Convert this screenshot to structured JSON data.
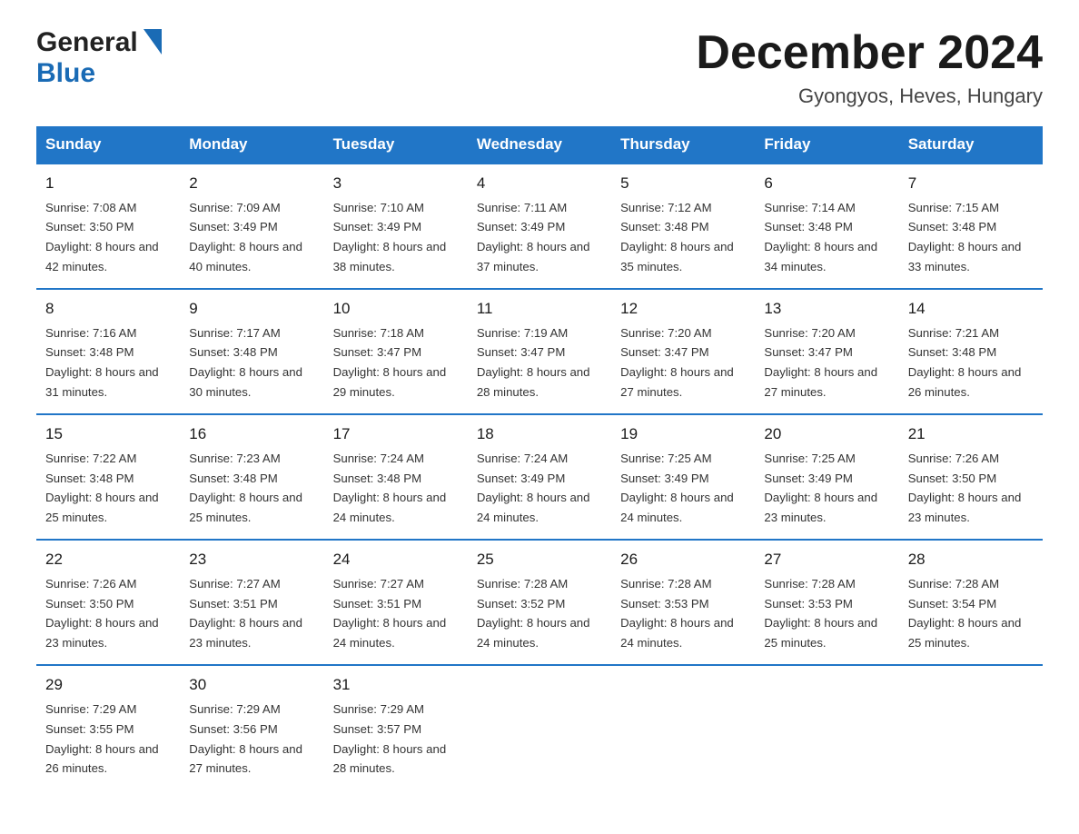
{
  "logo": {
    "general": "General",
    "blue": "Blue"
  },
  "title": "December 2024",
  "subtitle": "Gyongyos, Heves, Hungary",
  "days_of_week": [
    "Sunday",
    "Monday",
    "Tuesday",
    "Wednesday",
    "Thursday",
    "Friday",
    "Saturday"
  ],
  "weeks": [
    [
      {
        "day": "1",
        "sunrise": "7:08 AM",
        "sunset": "3:50 PM",
        "daylight": "8 hours and 42 minutes."
      },
      {
        "day": "2",
        "sunrise": "7:09 AM",
        "sunset": "3:49 PM",
        "daylight": "8 hours and 40 minutes."
      },
      {
        "day": "3",
        "sunrise": "7:10 AM",
        "sunset": "3:49 PM",
        "daylight": "8 hours and 38 minutes."
      },
      {
        "day": "4",
        "sunrise": "7:11 AM",
        "sunset": "3:49 PM",
        "daylight": "8 hours and 37 minutes."
      },
      {
        "day": "5",
        "sunrise": "7:12 AM",
        "sunset": "3:48 PM",
        "daylight": "8 hours and 35 minutes."
      },
      {
        "day": "6",
        "sunrise": "7:14 AM",
        "sunset": "3:48 PM",
        "daylight": "8 hours and 34 minutes."
      },
      {
        "day": "7",
        "sunrise": "7:15 AM",
        "sunset": "3:48 PM",
        "daylight": "8 hours and 33 minutes."
      }
    ],
    [
      {
        "day": "8",
        "sunrise": "7:16 AM",
        "sunset": "3:48 PM",
        "daylight": "8 hours and 31 minutes."
      },
      {
        "day": "9",
        "sunrise": "7:17 AM",
        "sunset": "3:48 PM",
        "daylight": "8 hours and 30 minutes."
      },
      {
        "day": "10",
        "sunrise": "7:18 AM",
        "sunset": "3:47 PM",
        "daylight": "8 hours and 29 minutes."
      },
      {
        "day": "11",
        "sunrise": "7:19 AM",
        "sunset": "3:47 PM",
        "daylight": "8 hours and 28 minutes."
      },
      {
        "day": "12",
        "sunrise": "7:20 AM",
        "sunset": "3:47 PM",
        "daylight": "8 hours and 27 minutes."
      },
      {
        "day": "13",
        "sunrise": "7:20 AM",
        "sunset": "3:47 PM",
        "daylight": "8 hours and 27 minutes."
      },
      {
        "day": "14",
        "sunrise": "7:21 AM",
        "sunset": "3:48 PM",
        "daylight": "8 hours and 26 minutes."
      }
    ],
    [
      {
        "day": "15",
        "sunrise": "7:22 AM",
        "sunset": "3:48 PM",
        "daylight": "8 hours and 25 minutes."
      },
      {
        "day": "16",
        "sunrise": "7:23 AM",
        "sunset": "3:48 PM",
        "daylight": "8 hours and 25 minutes."
      },
      {
        "day": "17",
        "sunrise": "7:24 AM",
        "sunset": "3:48 PM",
        "daylight": "8 hours and 24 minutes."
      },
      {
        "day": "18",
        "sunrise": "7:24 AM",
        "sunset": "3:49 PM",
        "daylight": "8 hours and 24 minutes."
      },
      {
        "day": "19",
        "sunrise": "7:25 AM",
        "sunset": "3:49 PM",
        "daylight": "8 hours and 24 minutes."
      },
      {
        "day": "20",
        "sunrise": "7:25 AM",
        "sunset": "3:49 PM",
        "daylight": "8 hours and 23 minutes."
      },
      {
        "day": "21",
        "sunrise": "7:26 AM",
        "sunset": "3:50 PM",
        "daylight": "8 hours and 23 minutes."
      }
    ],
    [
      {
        "day": "22",
        "sunrise": "7:26 AM",
        "sunset": "3:50 PM",
        "daylight": "8 hours and 23 minutes."
      },
      {
        "day": "23",
        "sunrise": "7:27 AM",
        "sunset": "3:51 PM",
        "daylight": "8 hours and 23 minutes."
      },
      {
        "day": "24",
        "sunrise": "7:27 AM",
        "sunset": "3:51 PM",
        "daylight": "8 hours and 24 minutes."
      },
      {
        "day": "25",
        "sunrise": "7:28 AM",
        "sunset": "3:52 PM",
        "daylight": "8 hours and 24 minutes."
      },
      {
        "day": "26",
        "sunrise": "7:28 AM",
        "sunset": "3:53 PM",
        "daylight": "8 hours and 24 minutes."
      },
      {
        "day": "27",
        "sunrise": "7:28 AM",
        "sunset": "3:53 PM",
        "daylight": "8 hours and 25 minutes."
      },
      {
        "day": "28",
        "sunrise": "7:28 AM",
        "sunset": "3:54 PM",
        "daylight": "8 hours and 25 minutes."
      }
    ],
    [
      {
        "day": "29",
        "sunrise": "7:29 AM",
        "sunset": "3:55 PM",
        "daylight": "8 hours and 26 minutes."
      },
      {
        "day": "30",
        "sunrise": "7:29 AM",
        "sunset": "3:56 PM",
        "daylight": "8 hours and 27 minutes."
      },
      {
        "day": "31",
        "sunrise": "7:29 AM",
        "sunset": "3:57 PM",
        "daylight": "8 hours and 28 minutes."
      },
      null,
      null,
      null,
      null
    ]
  ]
}
